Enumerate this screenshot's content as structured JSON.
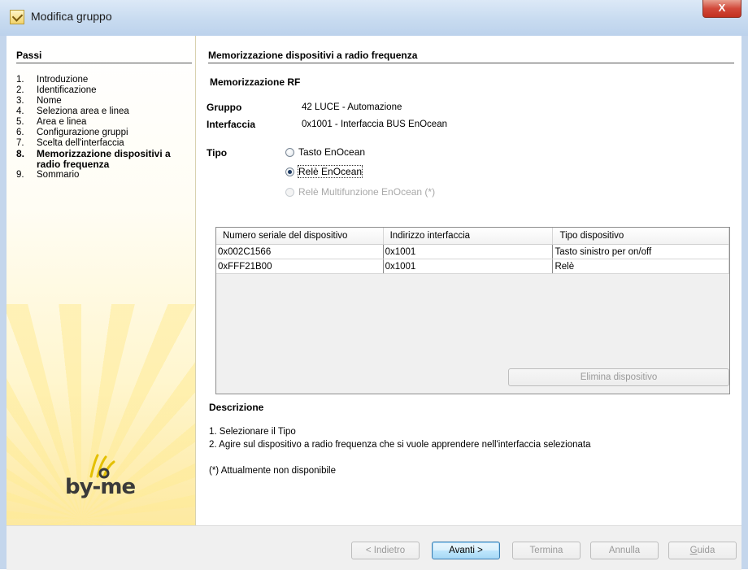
{
  "window": {
    "title": "Modifica gruppo",
    "close_glyph": "X"
  },
  "steps": {
    "title": "Passi",
    "items": [
      {
        "num": "1.",
        "label": "Introduzione"
      },
      {
        "num": "2.",
        "label": "Identificazione"
      },
      {
        "num": "3.",
        "label": "Nome"
      },
      {
        "num": "4.",
        "label": "Seleziona area e linea"
      },
      {
        "num": "5.",
        "label": "Area e linea"
      },
      {
        "num": "6.",
        "label": "Configurazione gruppi"
      },
      {
        "num": "7.",
        "label": "Scelta dell'interfaccia"
      },
      {
        "num": "8.",
        "label": "Memorizzazione dispositivi a radio frequenza",
        "active": true
      },
      {
        "num": "9.",
        "label": "Sommario"
      }
    ]
  },
  "logo": {
    "text": "by-me"
  },
  "main": {
    "section_title": "Memorizzazione dispositivi a radio frequenza",
    "sub_title": "Memorizzazione RF",
    "group_label": "Gruppo",
    "group_value": "42  LUCE  - Automazione",
    "interface_label": "Interfaccia",
    "interface_value": "0x1001 - Interfaccia BUS EnOcean",
    "type_label": "Tipo",
    "type_options": [
      {
        "label": "Tasto EnOcean",
        "checked": false,
        "enabled": true
      },
      {
        "label": "Relè EnOcean",
        "checked": true,
        "enabled": true
      },
      {
        "label": "Relè Multifunzione EnOcean (*)",
        "checked": false,
        "enabled": false
      }
    ],
    "table": {
      "columns": [
        "Numero seriale del dispositivo",
        "Indirizzo interfaccia",
        "Tipo dispositivo"
      ],
      "rows": [
        [
          "0x002C1566",
          "0x1001",
          "Tasto sinistro per on/off"
        ],
        [
          "0xFFF21B00",
          "0x1001",
          "Relè"
        ]
      ]
    },
    "delete_button": "Elimina dispositivo",
    "description_title": "Descrizione",
    "description_lines": [
      "1. Selezionare il Tipo",
      "2. Agire sul dispositivo a radio frequenza che si vuole apprendere nell'interfaccia selezionata"
    ],
    "note": "(*) Attualmente non disponibile"
  },
  "footer": {
    "back": "< Indietro",
    "next": "Avanti >",
    "finish": "Termina",
    "cancel": "Annulla",
    "help_first": "G",
    "help_rest": "uida"
  },
  "colors": {
    "titlebar": "#c8dbf0",
    "close": "#d2493a",
    "panel_gradient_end": "#fde9a0"
  }
}
